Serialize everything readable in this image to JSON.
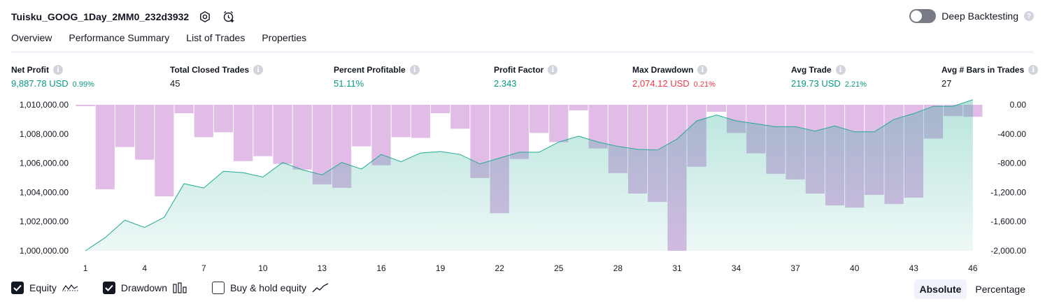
{
  "header": {
    "title": "Tuisku_GOOG_1Day_2MM0_232d3932",
    "settings_icon": "settings-icon",
    "alert_icon": "add-alert-icon",
    "deep_backtesting_label": "Deep Backtesting",
    "deep_backtesting_on": false,
    "help_glyph": "?"
  },
  "tabs": [
    {
      "label": "Overview",
      "active": true
    },
    {
      "label": "Performance Summary",
      "active": false
    },
    {
      "label": "List of Trades",
      "active": false
    },
    {
      "label": "Properties",
      "active": false
    }
  ],
  "metrics": [
    {
      "label": "Net Profit",
      "value": "9,887.78 USD",
      "pct": "0.99%",
      "tone": "green"
    },
    {
      "label": "Total Closed Trades",
      "value": "45",
      "pct": "",
      "tone": "dark"
    },
    {
      "label": "Percent Profitable",
      "value": "51.11%",
      "pct": "",
      "tone": "green"
    },
    {
      "label": "Profit Factor",
      "value": "2.343",
      "pct": "",
      "tone": "green"
    },
    {
      "label": "Max Drawdown",
      "value": "2,074.12 USD",
      "pct": "0.21%",
      "tone": "red"
    },
    {
      "label": "Avg Trade",
      "value": "219.73 USD",
      "pct": "2.21%",
      "tone": "green"
    },
    {
      "label": "Avg # Bars in Trades",
      "value": "27",
      "pct": "",
      "tone": "dark"
    }
  ],
  "info_glyph": "i",
  "chart_data": {
    "type": "bar+area",
    "x": [
      1,
      2,
      3,
      4,
      5,
      6,
      7,
      8,
      9,
      10,
      11,
      12,
      13,
      14,
      15,
      16,
      17,
      18,
      19,
      20,
      21,
      22,
      23,
      24,
      25,
      26,
      27,
      28,
      29,
      30,
      31,
      32,
      33,
      34,
      35,
      36,
      37,
      38,
      39,
      40,
      41,
      42,
      43,
      44,
      45,
      46
    ],
    "x_ticks": [
      "1",
      "4",
      "7",
      "10",
      "13",
      "16",
      "19",
      "22",
      "25",
      "28",
      "31",
      "34",
      "37",
      "40",
      "43",
      "46"
    ],
    "left_axis": {
      "ticks": [
        "1,010,000.00",
        "1,008,000.00",
        "1,006,000.00",
        "1,004,000.00",
        "1,002,000.00",
        "1,000,000.00"
      ],
      "range": [
        1000000,
        1010000
      ]
    },
    "right_axis": {
      "ticks": [
        "0.00",
        "-400.00",
        "-800.00",
        "-1,200.00",
        "-1,600.00",
        "-2,000.00"
      ],
      "range": [
        -2074.12,
        0
      ]
    },
    "series": [
      {
        "name": "Equity",
        "kind": "area",
        "color": "#22ab94",
        "values": [
          1000000,
          1000900,
          1002100,
          1001600,
          1002300,
          1004600,
          1004300,
          1005450,
          1005350,
          1005050,
          1006050,
          1005550,
          1005200,
          1006050,
          1005600,
          1006600,
          1006100,
          1006700,
          1006800,
          1006600,
          1005950,
          1006350,
          1006750,
          1006750,
          1007450,
          1007850,
          1007450,
          1007150,
          1006950,
          1006900,
          1007650,
          1008900,
          1009300,
          1008900,
          1008700,
          1008500,
          1008500,
          1008200,
          1008550,
          1008150,
          1008150,
          1009000,
          1009400,
          1009900,
          1009900,
          1010350
        ]
      },
      {
        "name": "Drawdown",
        "kind": "bar",
        "color": "#ce93d8",
        "values": [
          -20,
          -1200,
          -600,
          -780,
          -1300,
          -120,
          -460,
          -390,
          -800,
          -730,
          -840,
          -920,
          -1130,
          -1180,
          -590,
          -860,
          -460,
          -470,
          -120,
          -340,
          -1040,
          -1540,
          -770,
          -400,
          -530,
          -80,
          -620,
          -970,
          -1260,
          -1380,
          -2074.12,
          -880,
          -100,
          -400,
          -690,
          -980,
          -1060,
          -1260,
          -1430,
          -1460,
          -1280,
          -1410,
          -1320,
          -480,
          -160,
          -170
        ]
      }
    ],
    "legend": [
      {
        "label": "Equity",
        "checked": true,
        "icon": "equity-line-icon"
      },
      {
        "label": "Drawdown",
        "checked": true,
        "icon": "drawdown-bars-icon"
      },
      {
        "label": "Buy & hold equity",
        "checked": false,
        "icon": "buyhold-line-icon"
      }
    ],
    "grid": false
  },
  "view_mode": {
    "options": [
      "Absolute",
      "Percentage"
    ],
    "selected": "Absolute"
  }
}
